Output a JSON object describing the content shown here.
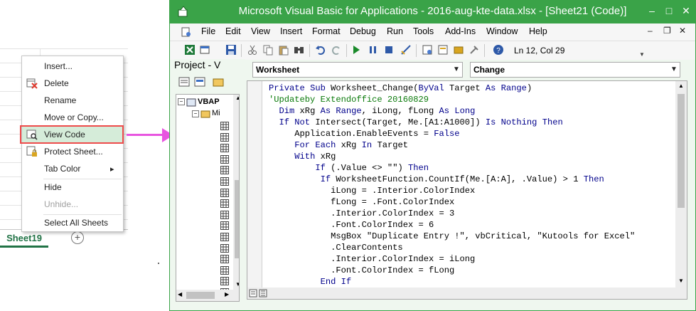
{
  "excel": {
    "sheet_tab": "Sheet19",
    "add_sheet": "+",
    "context_menu": [
      {
        "label": "Insert...",
        "icon": "none",
        "disabled": false
      },
      {
        "label": "Delete",
        "icon": "delete-sheet-icon",
        "disabled": false
      },
      {
        "label": "Rename",
        "icon": "none",
        "disabled": false
      },
      {
        "label": "Move or Copy...",
        "icon": "none",
        "disabled": false
      },
      {
        "label": "View Code",
        "icon": "view-code-icon",
        "disabled": false,
        "highlighted": true
      },
      {
        "label": "Protect Sheet...",
        "icon": "protect-sheet-icon",
        "disabled": false
      },
      {
        "label": "Tab Color",
        "icon": "none",
        "disabled": false,
        "submenu": "▸"
      },
      {
        "label": "Hide",
        "icon": "none",
        "disabled": false
      },
      {
        "label": "Unhide...",
        "icon": "none",
        "disabled": true
      },
      {
        "label": "Select All Sheets",
        "icon": "none",
        "disabled": false
      }
    ]
  },
  "vba": {
    "title": "Microsoft Visual Basic for Applications - 2016-aug-kte-data.xlsx - [Sheet21 (Code)]",
    "window_buttons": {
      "minimize": "–",
      "maximize": "□",
      "close": "✕"
    },
    "menu": [
      "File",
      "Edit",
      "View",
      "Insert",
      "Format",
      "Debug",
      "Run",
      "Tools",
      "Add-Ins",
      "Window",
      "Help"
    ],
    "mdi_buttons": {
      "minimize": "–",
      "restore": "❐",
      "close": "✕"
    },
    "position": "Ln 12, Col 29",
    "project_title": "Project - V",
    "tree": {
      "root": "VBAP",
      "folder": "Mi"
    },
    "object_dropdown": "Worksheet",
    "procedure_dropdown": "Change",
    "code_lines": [
      "Private Sub Worksheet_Change(ByVal Target As Range)",
      "'Updateby Extendoffice 20160829",
      "  Dim xRg As Range, iLong, fLong As Long",
      "  If Not Intersect(Target, Me.[A1:A1000]) Is Nothing Then",
      "     Application.EnableEvents = False",
      "     For Each xRg In Target",
      "     With xRg",
      "         If (.Value <> \"\") Then",
      "          If WorksheetFunction.CountIf(Me.[A:A], .Value) > 1 Then",
      "            iLong = .Interior.ColorIndex",
      "            fLong = .Font.ColorIndex",
      "            .Interior.ColorIndex = 3",
      "            .Font.ColorIndex = 6",
      "            MsgBox \"Duplicate Entry !\", vbCritical, \"Kutools for Excel\"",
      "            .ClearContents",
      "            .Interior.ColorIndex = iLong",
      "            .Font.ColorIndex = fLong",
      "          End If"
    ]
  },
  "colors": {
    "title_bar": "#3aa348",
    "highlight_box": "#ee4b4b",
    "arrow": "#e855e0",
    "keyword": "#00008b",
    "comment": "#0a7a0a"
  }
}
